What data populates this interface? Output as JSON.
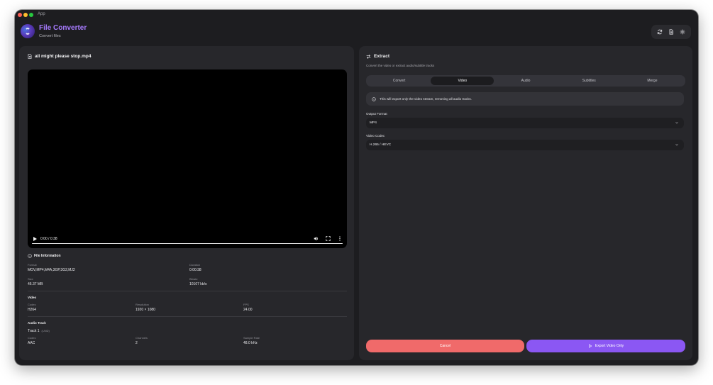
{
  "window": {
    "title": "App"
  },
  "header": {
    "app_name": "File Converter",
    "subtitle": "Convert files",
    "actions": [
      "refresh-icon",
      "document-icon",
      "gear-icon"
    ]
  },
  "file": {
    "name": "all might please stop.mp4",
    "player": {
      "time": "0:00 / 0:38"
    }
  },
  "info": {
    "heading": "File Information",
    "general": [
      {
        "label": "Format",
        "value": "MOV,MP4,M4A,3GP,3G2,MJ2"
      },
      {
        "label": "Duration",
        "value": "0:00:38"
      },
      {
        "label": "Size",
        "value": "46.37 MB"
      },
      {
        "label": "Bitrate",
        "value": "10107 kb/s"
      }
    ],
    "video": {
      "heading": "Video",
      "fields": [
        {
          "label": "Codec",
          "value": "H264"
        },
        {
          "label": "Resolution",
          "value": "1920 × 1080"
        },
        {
          "label": "FPS",
          "value": "24.00"
        }
      ]
    },
    "audio": {
      "heading": "Audio Track",
      "track": "Track 1",
      "language": "(UND)",
      "fields": [
        {
          "label": "Codec",
          "value": "AAC"
        },
        {
          "label": "Channels",
          "value": "2"
        },
        {
          "label": "Sample Rate",
          "value": "48.0 kHz"
        }
      ]
    }
  },
  "extract": {
    "heading": "Extract",
    "subtitle": "Convert the video or extract audio/subtitle tracks",
    "tabs": [
      {
        "label": "Convert",
        "active": false
      },
      {
        "label": "Video",
        "active": true
      },
      {
        "label": "Audio",
        "active": false
      },
      {
        "label": "Subtitles",
        "active": false
      },
      {
        "label": "Merge",
        "active": false
      }
    ],
    "notice": "This will export only the video stream, removing all audio tracks.",
    "output_format": {
      "label": "Output Format",
      "value": "MP4"
    },
    "video_codec": {
      "label": "Video Codec",
      "value": "H.265 / HEVC"
    },
    "cancel_label": "Cancel",
    "export_label": "Export Video Only"
  },
  "colors": {
    "accent": "#8b57f3",
    "brand": "#a77bff",
    "danger": "#f06a6a",
    "background": "#1d1d20",
    "panel": "#27272b"
  }
}
